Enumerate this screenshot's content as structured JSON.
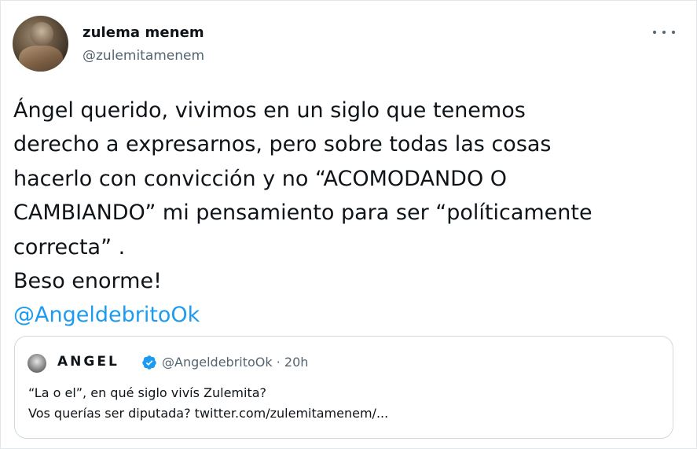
{
  "author": {
    "name": "zulema menem",
    "handle": "@zulemitamenem"
  },
  "tweet": {
    "lines": [
      "Ángel querido, vivimos en un siglo que tenemos",
      "derecho a expresarnos, pero sobre todas las cosas",
      "hacerlo con convicción y no “ACOMODANDO O",
      "CAMBIANDO” mi pensamiento para ser “políticamente",
      "correcta” .",
      "Beso enorme!"
    ],
    "mention": "@AngeldebritoOk"
  },
  "quoted_tweet": {
    "name": "ANGEL",
    "handle": "@AngeldebritoOk",
    "separator": "·",
    "time": "20h",
    "lines": [
      "“La o el”, en qué siglo vivís Zulemita?",
      "Vos querías ser diputada? twitter.com/zulemitamenem/..."
    ]
  },
  "icons": {
    "more": "more-options-icon",
    "verified": "verified-badge-icon"
  },
  "colors": {
    "link": "#1d9bf0",
    "secondary_text": "#536471",
    "border": "#cfd9de"
  }
}
